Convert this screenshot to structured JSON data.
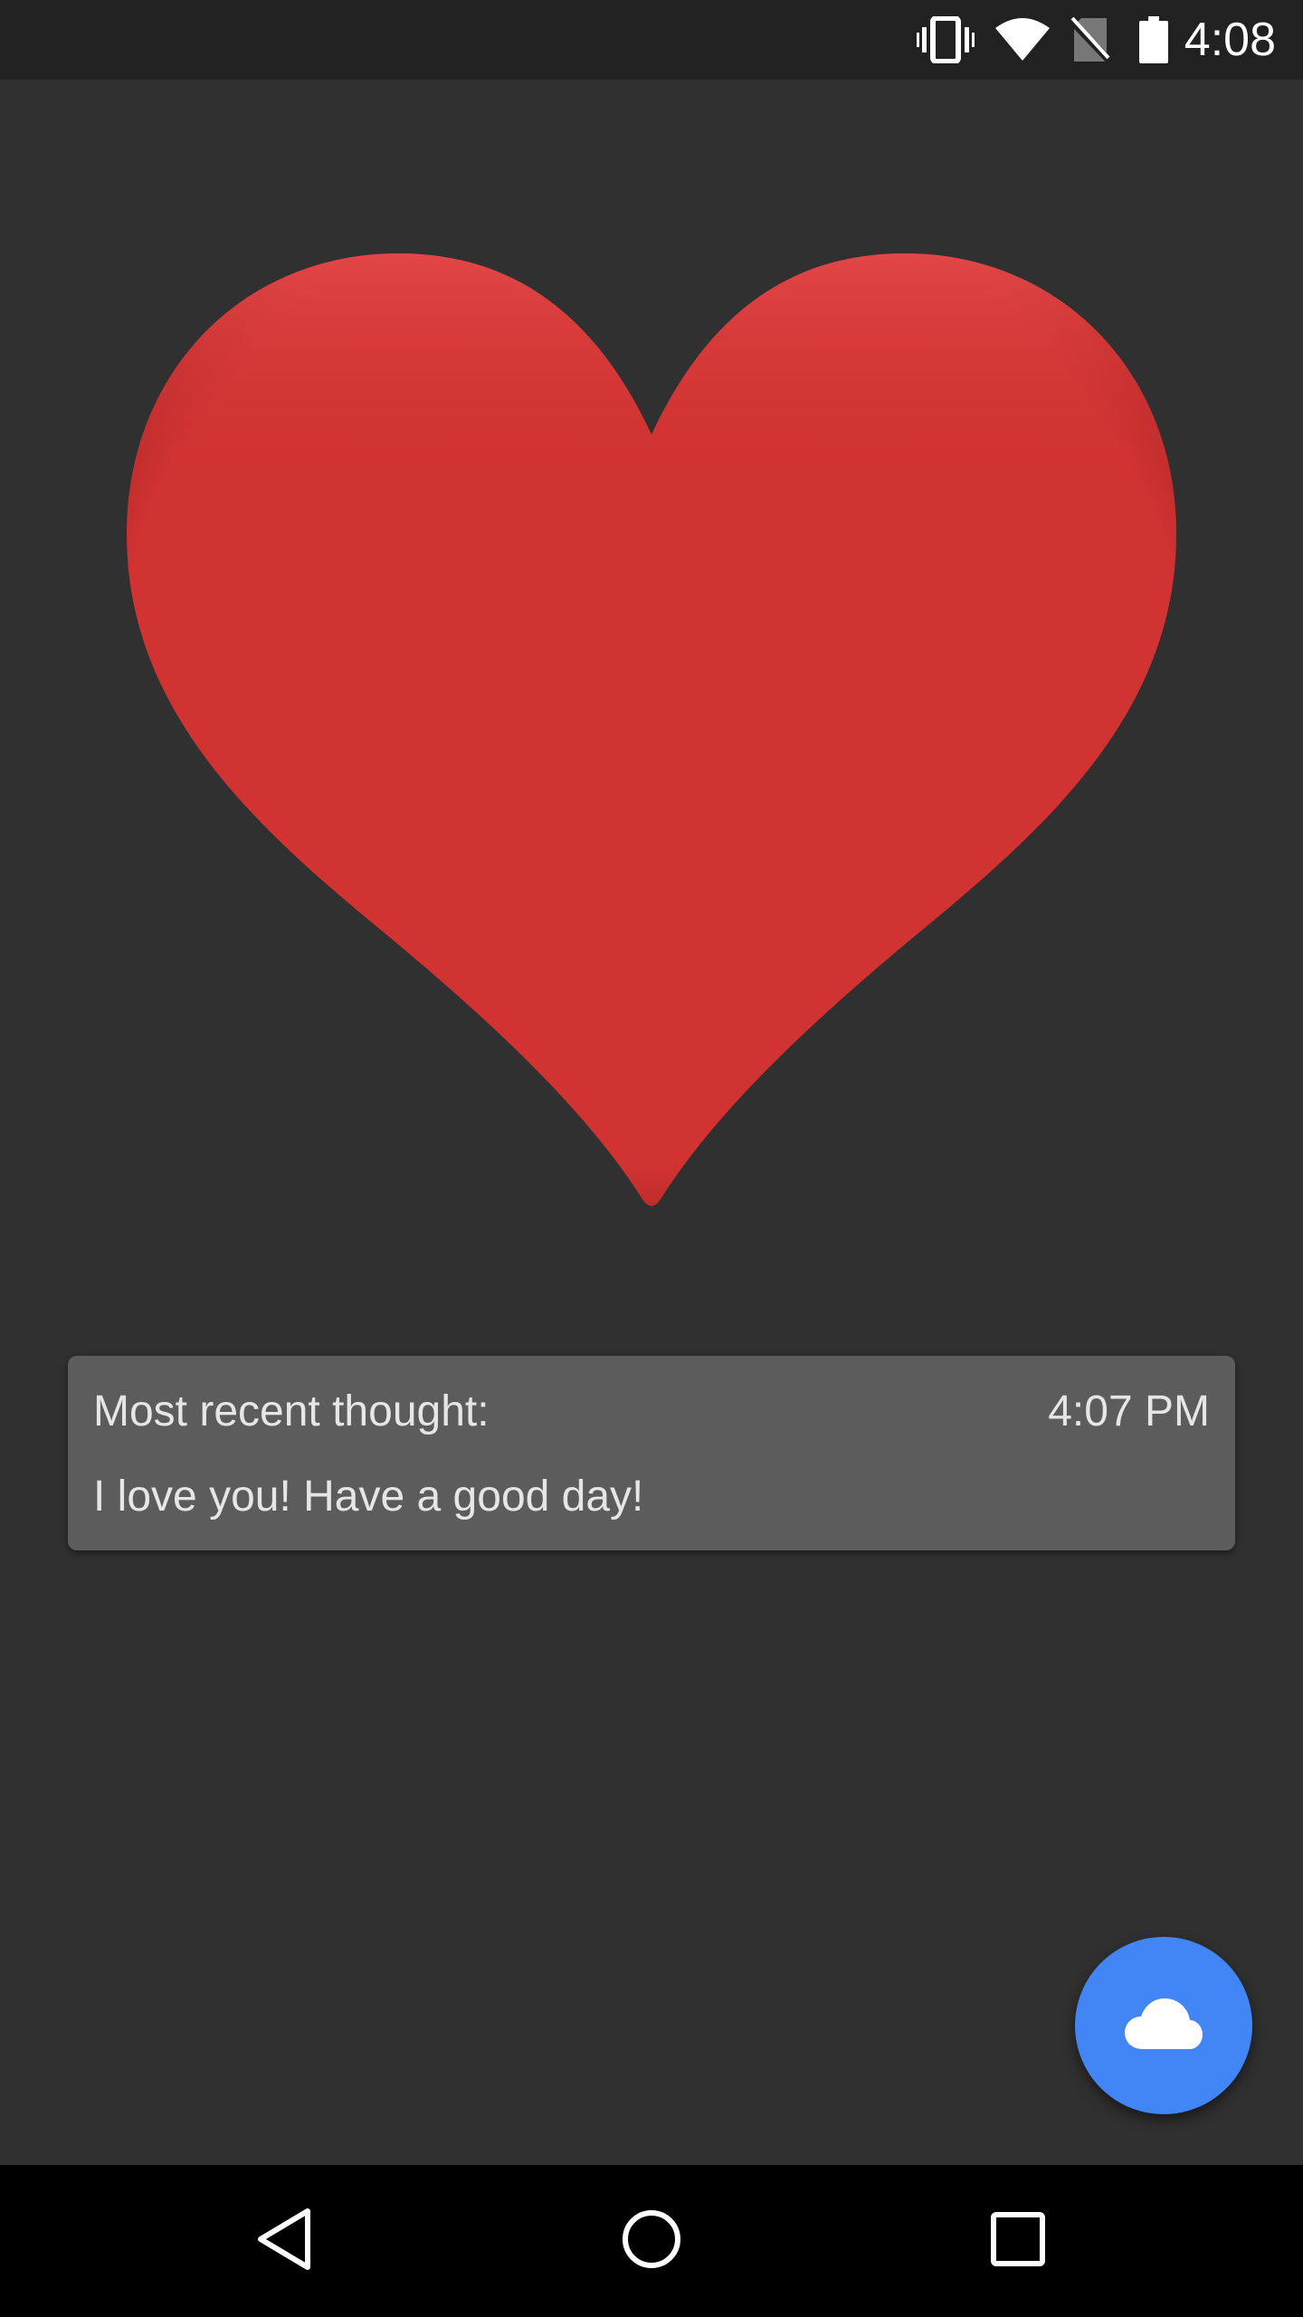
{
  "status_bar": {
    "time": "4:08",
    "icons": [
      "vibrate-icon",
      "wifi-icon",
      "no-sim-icon",
      "battery-icon"
    ]
  },
  "main": {
    "heart_color": "#d13232",
    "thought_card": {
      "label": "Most recent thought:",
      "time": "4:07 PM",
      "message": "I love you! Have a good day!"
    },
    "fab": {
      "icon": "cloud-icon",
      "color": "#4285f4"
    }
  },
  "nav_bar": {
    "buttons": [
      "back-icon",
      "home-icon",
      "recents-icon"
    ]
  }
}
